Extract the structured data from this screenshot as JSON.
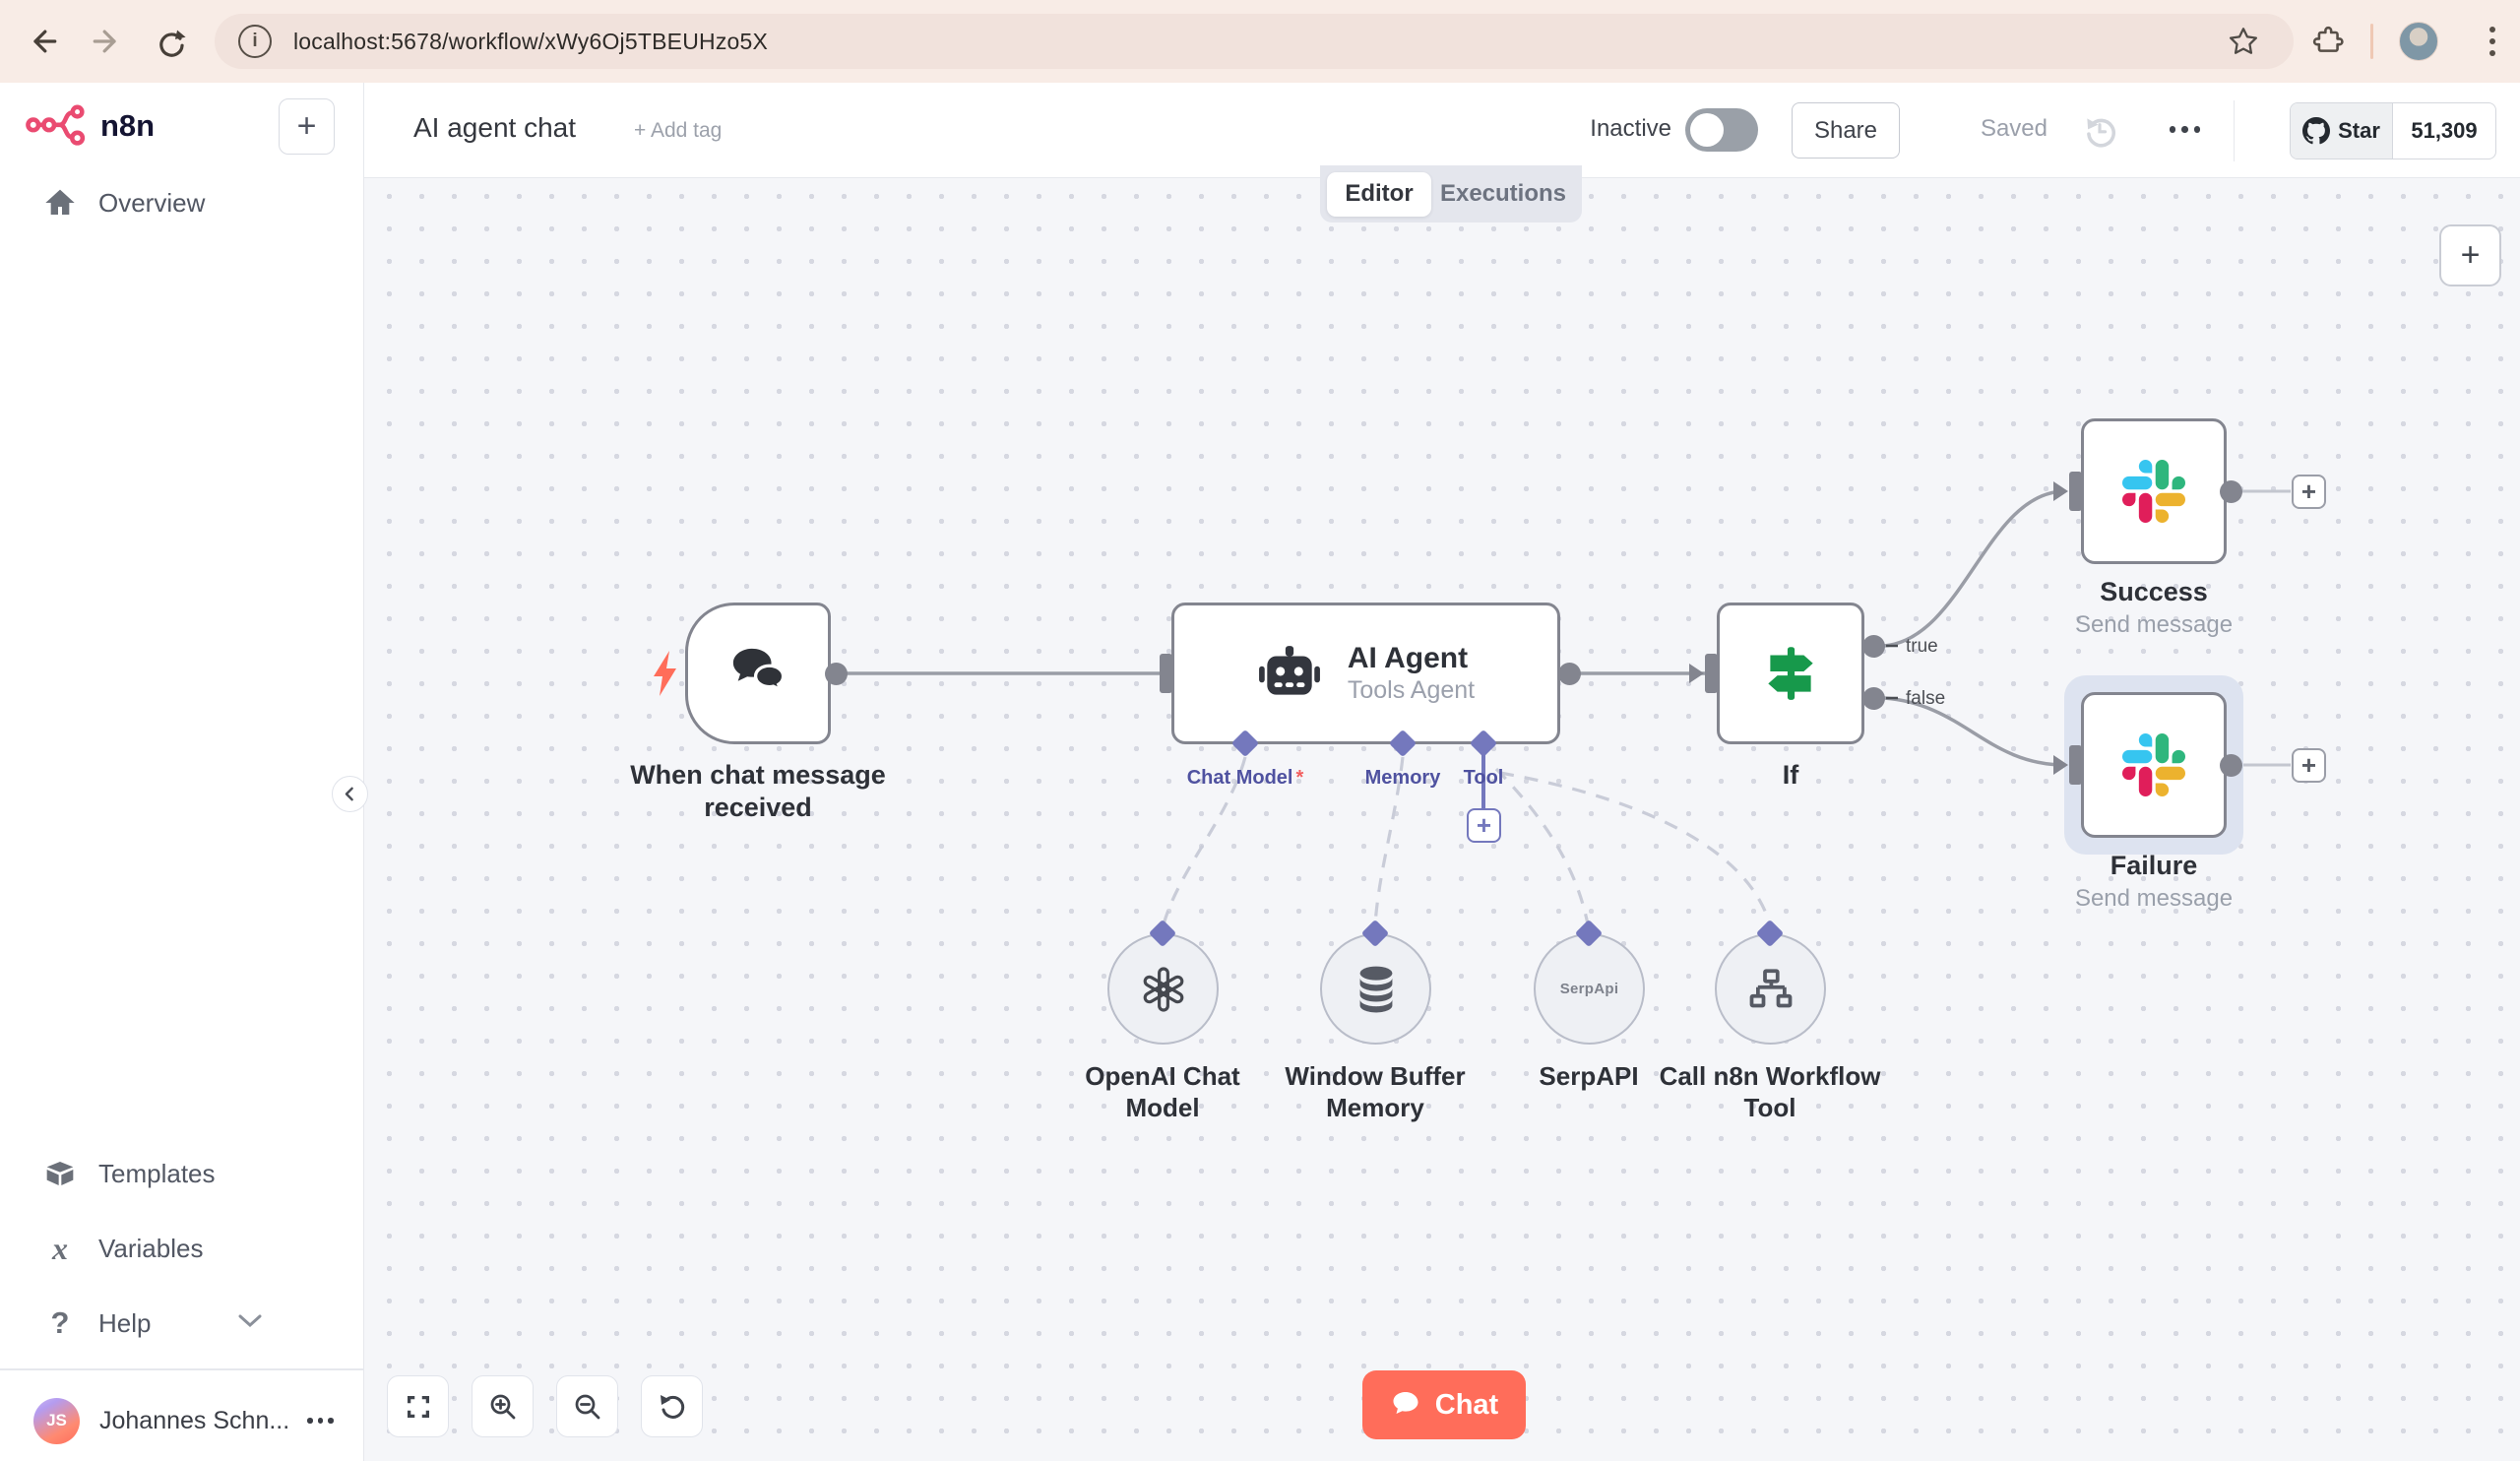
{
  "glyphs": {
    "plus": "+",
    "info": "i",
    "question": "?",
    "variables_x": "x",
    "required": "*"
  },
  "browser": {
    "url": "localhost:5678/workflow/xWy6Oj5TBEUHzo5X"
  },
  "sidebar": {
    "brand": "n8n",
    "overview": "Overview",
    "templates": "Templates",
    "variables": "Variables",
    "help": "Help",
    "user_name": "Johannes Schn...",
    "user_initials": "JS"
  },
  "header": {
    "title": "AI agent chat",
    "add_tag": "+ Add tag",
    "status": "Inactive",
    "share": "Share",
    "saved": "Saved",
    "github_star": "Star",
    "github_count": "51,309"
  },
  "tabs": {
    "editor": "Editor",
    "executions": "Executions"
  },
  "workflow": {
    "trigger": {
      "label": "When chat message received"
    },
    "agent": {
      "title": "AI Agent",
      "subtitle": "Tools Agent",
      "inputs": [
        {
          "label": "Chat Model"
        },
        {
          "label": "Memory"
        },
        {
          "label": "Tool"
        }
      ]
    },
    "if_node": {
      "label": "If",
      "true_label": "true",
      "false_label": "false"
    },
    "success": {
      "label": "Success",
      "subtitle": "Send message"
    },
    "failure": {
      "label": "Failure",
      "subtitle": "Send message"
    },
    "sub_nodes": [
      {
        "label": "OpenAI Chat Model"
      },
      {
        "label": "Window Buffer Memory"
      },
      {
        "label": "SerpAPI",
        "badge": "SerpApi"
      },
      {
        "label": "Call n8n Workflow Tool"
      }
    ],
    "chat_button": "Chat"
  },
  "colors": {
    "accent": "#ea4b71",
    "chat_button": "#ff6d5a",
    "if_green": "#17994b",
    "connector": "#7478bd",
    "slack_blue": "#36c5f0",
    "slack_green": "#2eb67d",
    "slack_yellow": "#ecb22e",
    "slack_red": "#e01e5a"
  }
}
